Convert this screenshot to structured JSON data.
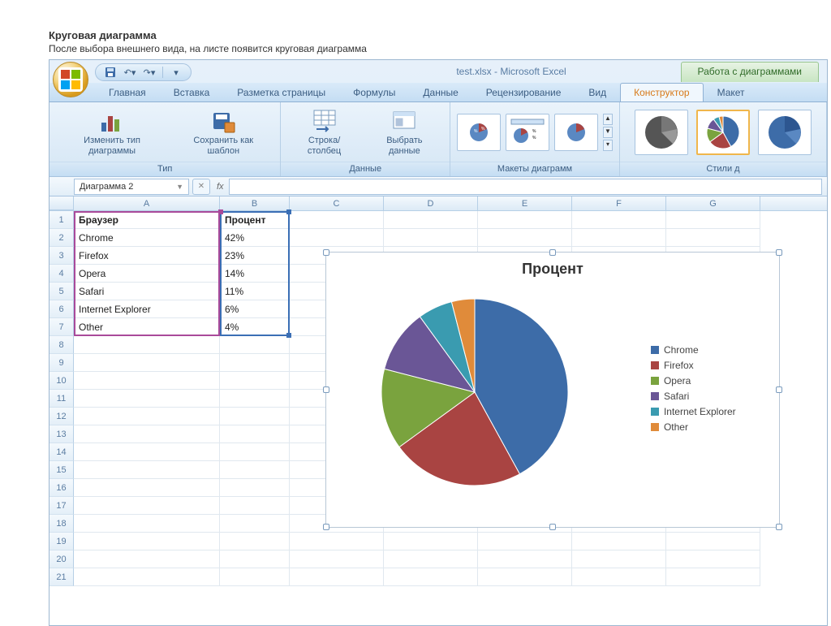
{
  "doc": {
    "title": "Круговая диаграмма",
    "sub": "После выбора внешнего вида, на листе появится круговая диаграмма"
  },
  "window": {
    "title": "test.xlsx - Microsoft Excel",
    "context_tools": "Работа с диаграммами"
  },
  "tabs": {
    "home": "Главная",
    "insert": "Вставка",
    "pagelayout": "Разметка страницы",
    "formulas": "Формулы",
    "data": "Данные",
    "review": "Рецензирование",
    "view": "Вид",
    "design": "Конструктор",
    "layout": "Макет"
  },
  "ribbon": {
    "change_type": "Изменить тип\nдиаграммы",
    "save_template": "Сохранить\nкак шаблон",
    "group_type": "Тип",
    "switch_rowcol": "Строка/столбец",
    "select_data": "Выбрать\nданные",
    "group_data": "Данные",
    "group_layouts": "Макеты диаграмм",
    "group_styles": "Стили д"
  },
  "namebox": "Диаграмма 2",
  "columns": [
    "A",
    "B",
    "C",
    "D",
    "E",
    "F",
    "G"
  ],
  "rows": [
    "1",
    "2",
    "3",
    "4",
    "5",
    "6",
    "7",
    "8",
    "9",
    "10",
    "11",
    "12",
    "13",
    "14",
    "15",
    "16",
    "17",
    "18",
    "19",
    "20",
    "21"
  ],
  "table": {
    "header": {
      "a": "Браузер",
      "b": "Процент"
    },
    "data": [
      {
        "a": "Chrome",
        "b": "42%"
      },
      {
        "a": "Firefox",
        "b": "23%"
      },
      {
        "a": "Opera",
        "b": "14%"
      },
      {
        "a": "Safari",
        "b": "11%"
      },
      {
        "a": "Internet Explorer",
        "b": "6%"
      },
      {
        "a": "Other",
        "b": "4%"
      }
    ]
  },
  "chart": {
    "title": "Процент"
  },
  "legend": {
    "chrome": "Chrome",
    "firefox": "Firefox",
    "opera": "Opera",
    "safari": "Safari",
    "ie": "Internet Explorer",
    "other": "Other"
  },
  "colors": {
    "chrome": "#3d6ca8",
    "firefox": "#a94442",
    "opera": "#7aa33e",
    "safari": "#6a5696",
    "ie": "#3a9bb0",
    "other": "#e08b3a"
  },
  "chart_data": {
    "type": "pie",
    "title": "Процент",
    "categories": [
      "Chrome",
      "Firefox",
      "Opera",
      "Safari",
      "Internet Explorer",
      "Other"
    ],
    "values": [
      42,
      23,
      14,
      11,
      6,
      4
    ],
    "series": [
      {
        "name": "Процент",
        "values": [
          42,
          23,
          14,
          11,
          6,
          4
        ]
      }
    ]
  }
}
